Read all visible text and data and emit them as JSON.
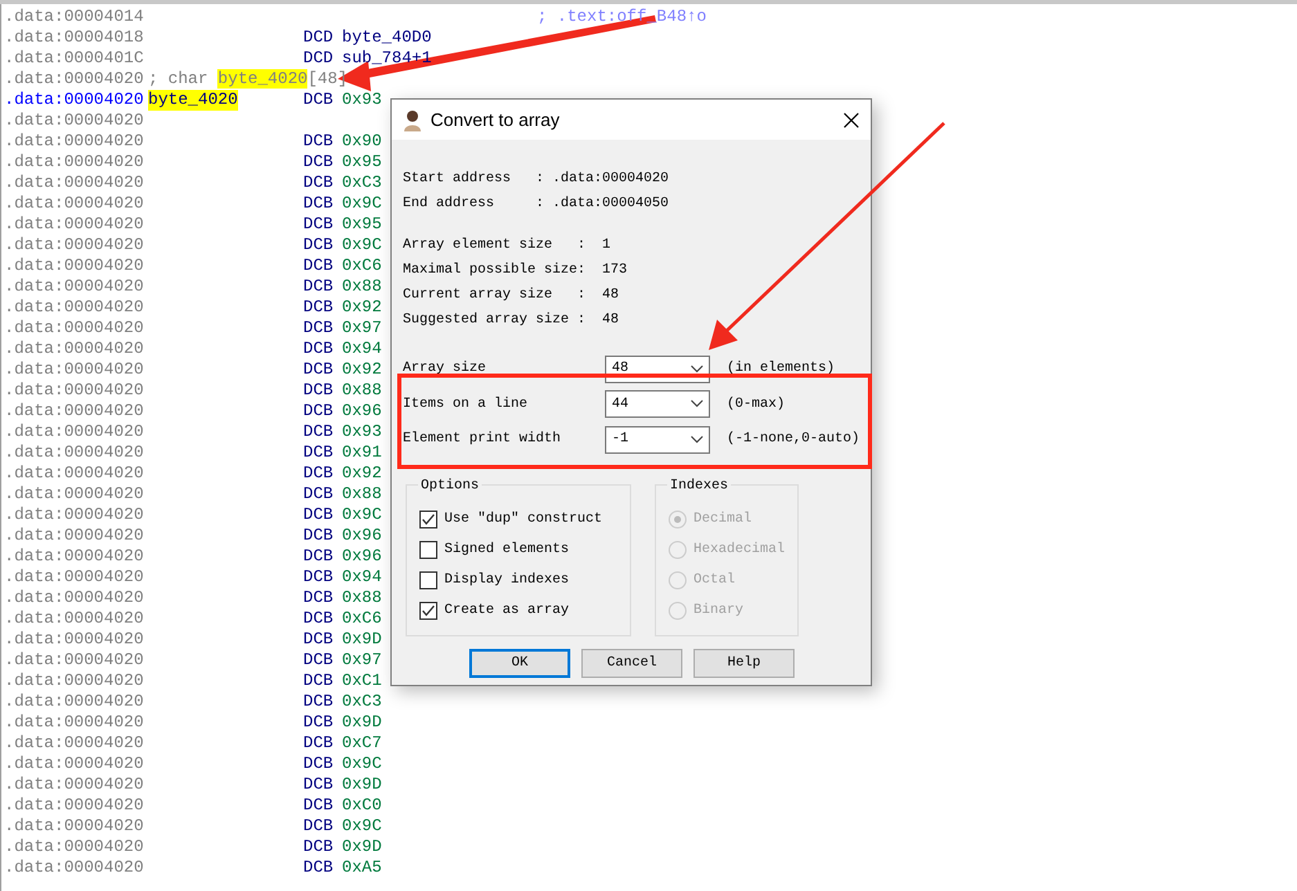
{
  "listing": {
    "rows": [
      {
        "address": ".data:00004014",
        "current": false,
        "comment": "; .text:off_B48↑o"
      },
      {
        "address": ".data:00004018",
        "current": false,
        "mnemonic": "DCD",
        "operand": "byte_40D0",
        "kind": "name"
      },
      {
        "address": ".data:0000401C",
        "current": false,
        "mnemonic": "DCD",
        "operand": "sub_784+1",
        "kind": "name"
      },
      {
        "address": ".data:00004020",
        "current": false,
        "declaration": {
          "prefix": "; char ",
          "name": "byte_4020",
          "highlighted": true,
          "suffix": "[48]"
        }
      },
      {
        "address": ".data:00004020",
        "current": true,
        "label": "byte_4020",
        "label_highlighted": true,
        "mnemonic": "DCB",
        "operand": "0x93",
        "kind": "number"
      },
      {
        "address": ".data:00004020",
        "current": false
      },
      {
        "address": ".data:00004020",
        "current": false,
        "mnemonic": "DCB",
        "operand": "0x90",
        "kind": "number"
      },
      {
        "address": ".data:00004020",
        "current": false,
        "mnemonic": "DCB",
        "operand": "0x95",
        "kind": "number"
      },
      {
        "address": ".data:00004020",
        "current": false,
        "mnemonic": "DCB",
        "operand": "0xC3",
        "kind": "number"
      },
      {
        "address": ".data:00004020",
        "current": false,
        "mnemonic": "DCB",
        "operand": "0x9C",
        "kind": "number"
      },
      {
        "address": ".data:00004020",
        "current": false,
        "mnemonic": "DCB",
        "operand": "0x95",
        "kind": "number"
      },
      {
        "address": ".data:00004020",
        "current": false,
        "mnemonic": "DCB",
        "operand": "0x9C",
        "kind": "number"
      },
      {
        "address": ".data:00004020",
        "current": false,
        "mnemonic": "DCB",
        "operand": "0xC6",
        "kind": "number"
      },
      {
        "address": ".data:00004020",
        "current": false,
        "mnemonic": "DCB",
        "operand": "0x88",
        "kind": "number"
      },
      {
        "address": ".data:00004020",
        "current": false,
        "mnemonic": "DCB",
        "operand": "0x92",
        "kind": "number"
      },
      {
        "address": ".data:00004020",
        "current": false,
        "mnemonic": "DCB",
        "operand": "0x97",
        "kind": "number"
      },
      {
        "address": ".data:00004020",
        "current": false,
        "mnemonic": "DCB",
        "operand": "0x94",
        "kind": "number"
      },
      {
        "address": ".data:00004020",
        "current": false,
        "mnemonic": "DCB",
        "operand": "0x92",
        "kind": "number"
      },
      {
        "address": ".data:00004020",
        "current": false,
        "mnemonic": "DCB",
        "operand": "0x88",
        "kind": "number"
      },
      {
        "address": ".data:00004020",
        "current": false,
        "mnemonic": "DCB",
        "operand": "0x96",
        "kind": "number"
      },
      {
        "address": ".data:00004020",
        "current": false,
        "mnemonic": "DCB",
        "operand": "0x93",
        "kind": "number"
      },
      {
        "address": ".data:00004020",
        "current": false,
        "mnemonic": "DCB",
        "operand": "0x91",
        "kind": "number"
      },
      {
        "address": ".data:00004020",
        "current": false,
        "mnemonic": "DCB",
        "operand": "0x92",
        "kind": "number"
      },
      {
        "address": ".data:00004020",
        "current": false,
        "mnemonic": "DCB",
        "operand": "0x88",
        "kind": "number"
      },
      {
        "address": ".data:00004020",
        "current": false,
        "mnemonic": "DCB",
        "operand": "0x9C",
        "kind": "number"
      },
      {
        "address": ".data:00004020",
        "current": false,
        "mnemonic": "DCB",
        "operand": "0x96",
        "kind": "number"
      },
      {
        "address": ".data:00004020",
        "current": false,
        "mnemonic": "DCB",
        "operand": "0x96",
        "kind": "number"
      },
      {
        "address": ".data:00004020",
        "current": false,
        "mnemonic": "DCB",
        "operand": "0x94",
        "kind": "number"
      },
      {
        "address": ".data:00004020",
        "current": false,
        "mnemonic": "DCB",
        "operand": "0x88",
        "kind": "number"
      },
      {
        "address": ".data:00004020",
        "current": false,
        "mnemonic": "DCB",
        "operand": "0xC6",
        "kind": "number"
      },
      {
        "address": ".data:00004020",
        "current": false,
        "mnemonic": "DCB",
        "operand": "0x9D",
        "kind": "number"
      },
      {
        "address": ".data:00004020",
        "current": false,
        "mnemonic": "DCB",
        "operand": "0x97",
        "kind": "number"
      },
      {
        "address": ".data:00004020",
        "current": false,
        "mnemonic": "DCB",
        "operand": "0xC1",
        "kind": "number"
      },
      {
        "address": ".data:00004020",
        "current": false,
        "mnemonic": "DCB",
        "operand": "0xC3",
        "kind": "number"
      },
      {
        "address": ".data:00004020",
        "current": false,
        "mnemonic": "DCB",
        "operand": "0x9D",
        "kind": "number"
      },
      {
        "address": ".data:00004020",
        "current": false,
        "mnemonic": "DCB",
        "operand": "0xC7",
        "kind": "number"
      },
      {
        "address": ".data:00004020",
        "current": false,
        "mnemonic": "DCB",
        "operand": "0x9C",
        "kind": "number"
      },
      {
        "address": ".data:00004020",
        "current": false,
        "mnemonic": "DCB",
        "operand": "0x9D",
        "kind": "number"
      },
      {
        "address": ".data:00004020",
        "current": false,
        "mnemonic": "DCB",
        "operand": "0xC0",
        "kind": "number"
      },
      {
        "address": ".data:00004020",
        "current": false,
        "mnemonic": "DCB",
        "operand": "0x9C",
        "kind": "number"
      },
      {
        "address": ".data:00004020",
        "current": false,
        "mnemonic": "DCB",
        "operand": "0x9D",
        "kind": "number"
      },
      {
        "address": ".data:00004020",
        "current": false,
        "mnemonic": "DCB",
        "operand": "0xA5",
        "kind": "number"
      }
    ]
  },
  "dialog": {
    "title": "Convert to array",
    "address_info": [
      "Start address   : .data:00004020",
      "End address     : .data:00004050"
    ],
    "size_info": [
      "Array element size   :  1",
      "Maximal possible size:  173",
      "Current array size   :  48",
      "Suggested array size :  48"
    ],
    "fields": [
      {
        "label": "Array size",
        "value": "48",
        "hint": "(in elements)"
      },
      {
        "label": "Items on a line",
        "value": "44",
        "hint": "(0-max)"
      },
      {
        "label": "Element print width",
        "value": "-1",
        "hint": "(-1-none,0-auto)"
      }
    ],
    "options": {
      "title": "Options",
      "items": [
        {
          "label": "Use \"dup\" construct",
          "checked": true
        },
        {
          "label": "Signed elements",
          "checked": false
        },
        {
          "label": "Display indexes",
          "checked": false
        },
        {
          "label": "Create as array",
          "checked": true
        }
      ]
    },
    "indexes": {
      "title": "Indexes",
      "disabled": true,
      "items": [
        {
          "label": "Decimal",
          "selected": true
        },
        {
          "label": "Hexadecimal",
          "selected": false
        },
        {
          "label": "Octal",
          "selected": false
        },
        {
          "label": "Binary",
          "selected": false
        }
      ]
    },
    "buttons": [
      {
        "label": "OK",
        "default": true
      },
      {
        "label": "Cancel",
        "default": false
      },
      {
        "label": "Help",
        "default": false
      }
    ]
  }
}
